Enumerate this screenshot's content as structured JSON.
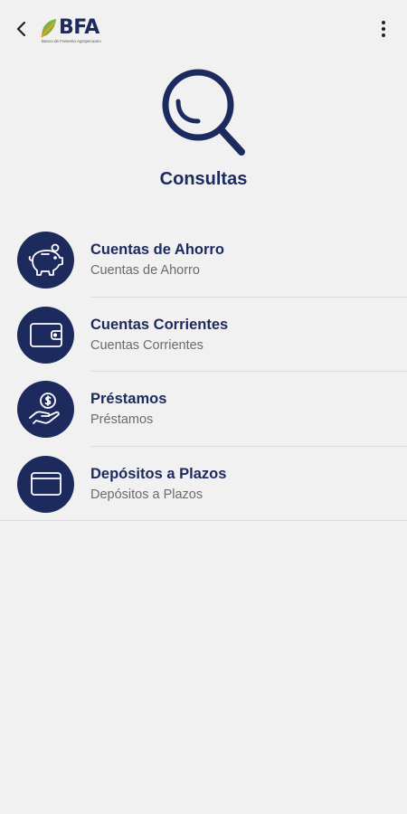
{
  "header": {
    "back_icon": "chevron-left-icon",
    "logo_text": "BFA",
    "logo_subtitle": "Banco de Fomento Agropecuario",
    "menu_icon": "more-vertical-icon"
  },
  "page": {
    "hero_icon": "search-icon",
    "title": "Consultas"
  },
  "items": [
    {
      "icon": "piggy-bank-icon",
      "title": "Cuentas de Ahorro",
      "subtitle": "Cuentas de Ahorro"
    },
    {
      "icon": "wallet-icon",
      "title": "Cuentas Corrientes",
      "subtitle": "Cuentas Corrientes"
    },
    {
      "icon": "loan-hand-icon",
      "title": "Préstamos",
      "subtitle": "Préstamos"
    },
    {
      "icon": "card-icon",
      "title": "Depósitos a Plazos",
      "subtitle": "Depósitos a Plazos"
    }
  ],
  "colors": {
    "primary": "#1c2a5e",
    "background": "#f1f1f1",
    "logo_green": "#7cb342",
    "logo_orange": "#f39c1f"
  }
}
